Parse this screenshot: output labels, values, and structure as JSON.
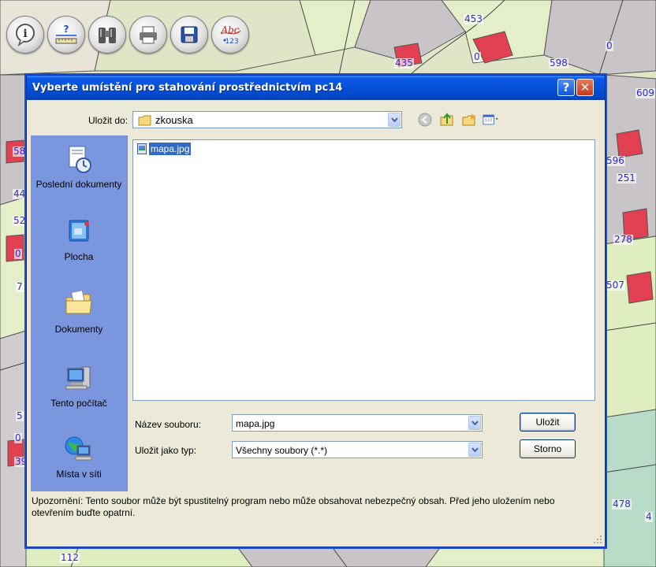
{
  "map": {
    "parcel_numbers": [
      "453",
      "435",
      "0",
      "598",
      "0",
      "609",
      "58",
      "44",
      "52",
      "0",
      "7",
      "596",
      "251",
      "278",
      "507",
      "5",
      "0",
      "39",
      "478",
      "4",
      "112"
    ]
  },
  "toolbar": {
    "buttons": [
      {
        "icon": "info-icon"
      },
      {
        "icon": "measure-icon"
      },
      {
        "icon": "binoculars-icon"
      },
      {
        "icon": "print-icon"
      },
      {
        "icon": "save-icon"
      },
      {
        "icon": "abc-123-icon"
      }
    ]
  },
  "dialog": {
    "title": "Vyberte umístění pro stahování prostřednictvím pc14",
    "help_glyph": "?",
    "close_glyph": "✕",
    "save_in_label": "Uložit do:",
    "save_in_value": "zkouska",
    "places": [
      {
        "label": "Poslední dokumenty",
        "icon": "recent-documents-icon"
      },
      {
        "label": "Plocha",
        "icon": "desktop-icon"
      },
      {
        "label": "Dokumenty",
        "icon": "documents-folder-icon"
      },
      {
        "label": "Tento počítač",
        "icon": "my-computer-icon"
      },
      {
        "label": "Místa v síti",
        "icon": "network-places-icon"
      }
    ],
    "files": [
      {
        "name": "mapa.jpg",
        "selected": true
      }
    ],
    "file_name_label": "Název souboru:",
    "file_name_value": "mapa.jpg",
    "save_type_label": "Uložit jako typ:",
    "save_type_value": "Všechny soubory (*.*)",
    "save_button": "Uložit",
    "cancel_button": "Storno",
    "warning": "Upozornění: Tento soubor může být spustitelný program nebo může obsahovat nebezpečný obsah. Před jeho uložením nebo otevřením buďte opatrní."
  },
  "colors": {
    "title_bar": "#0450d8",
    "places_bar": "#7a96df",
    "selection": "#316ac5",
    "dialog_bg": "#ece9d8",
    "parcel_label": "#2d2dc8",
    "building": "#e04050"
  }
}
